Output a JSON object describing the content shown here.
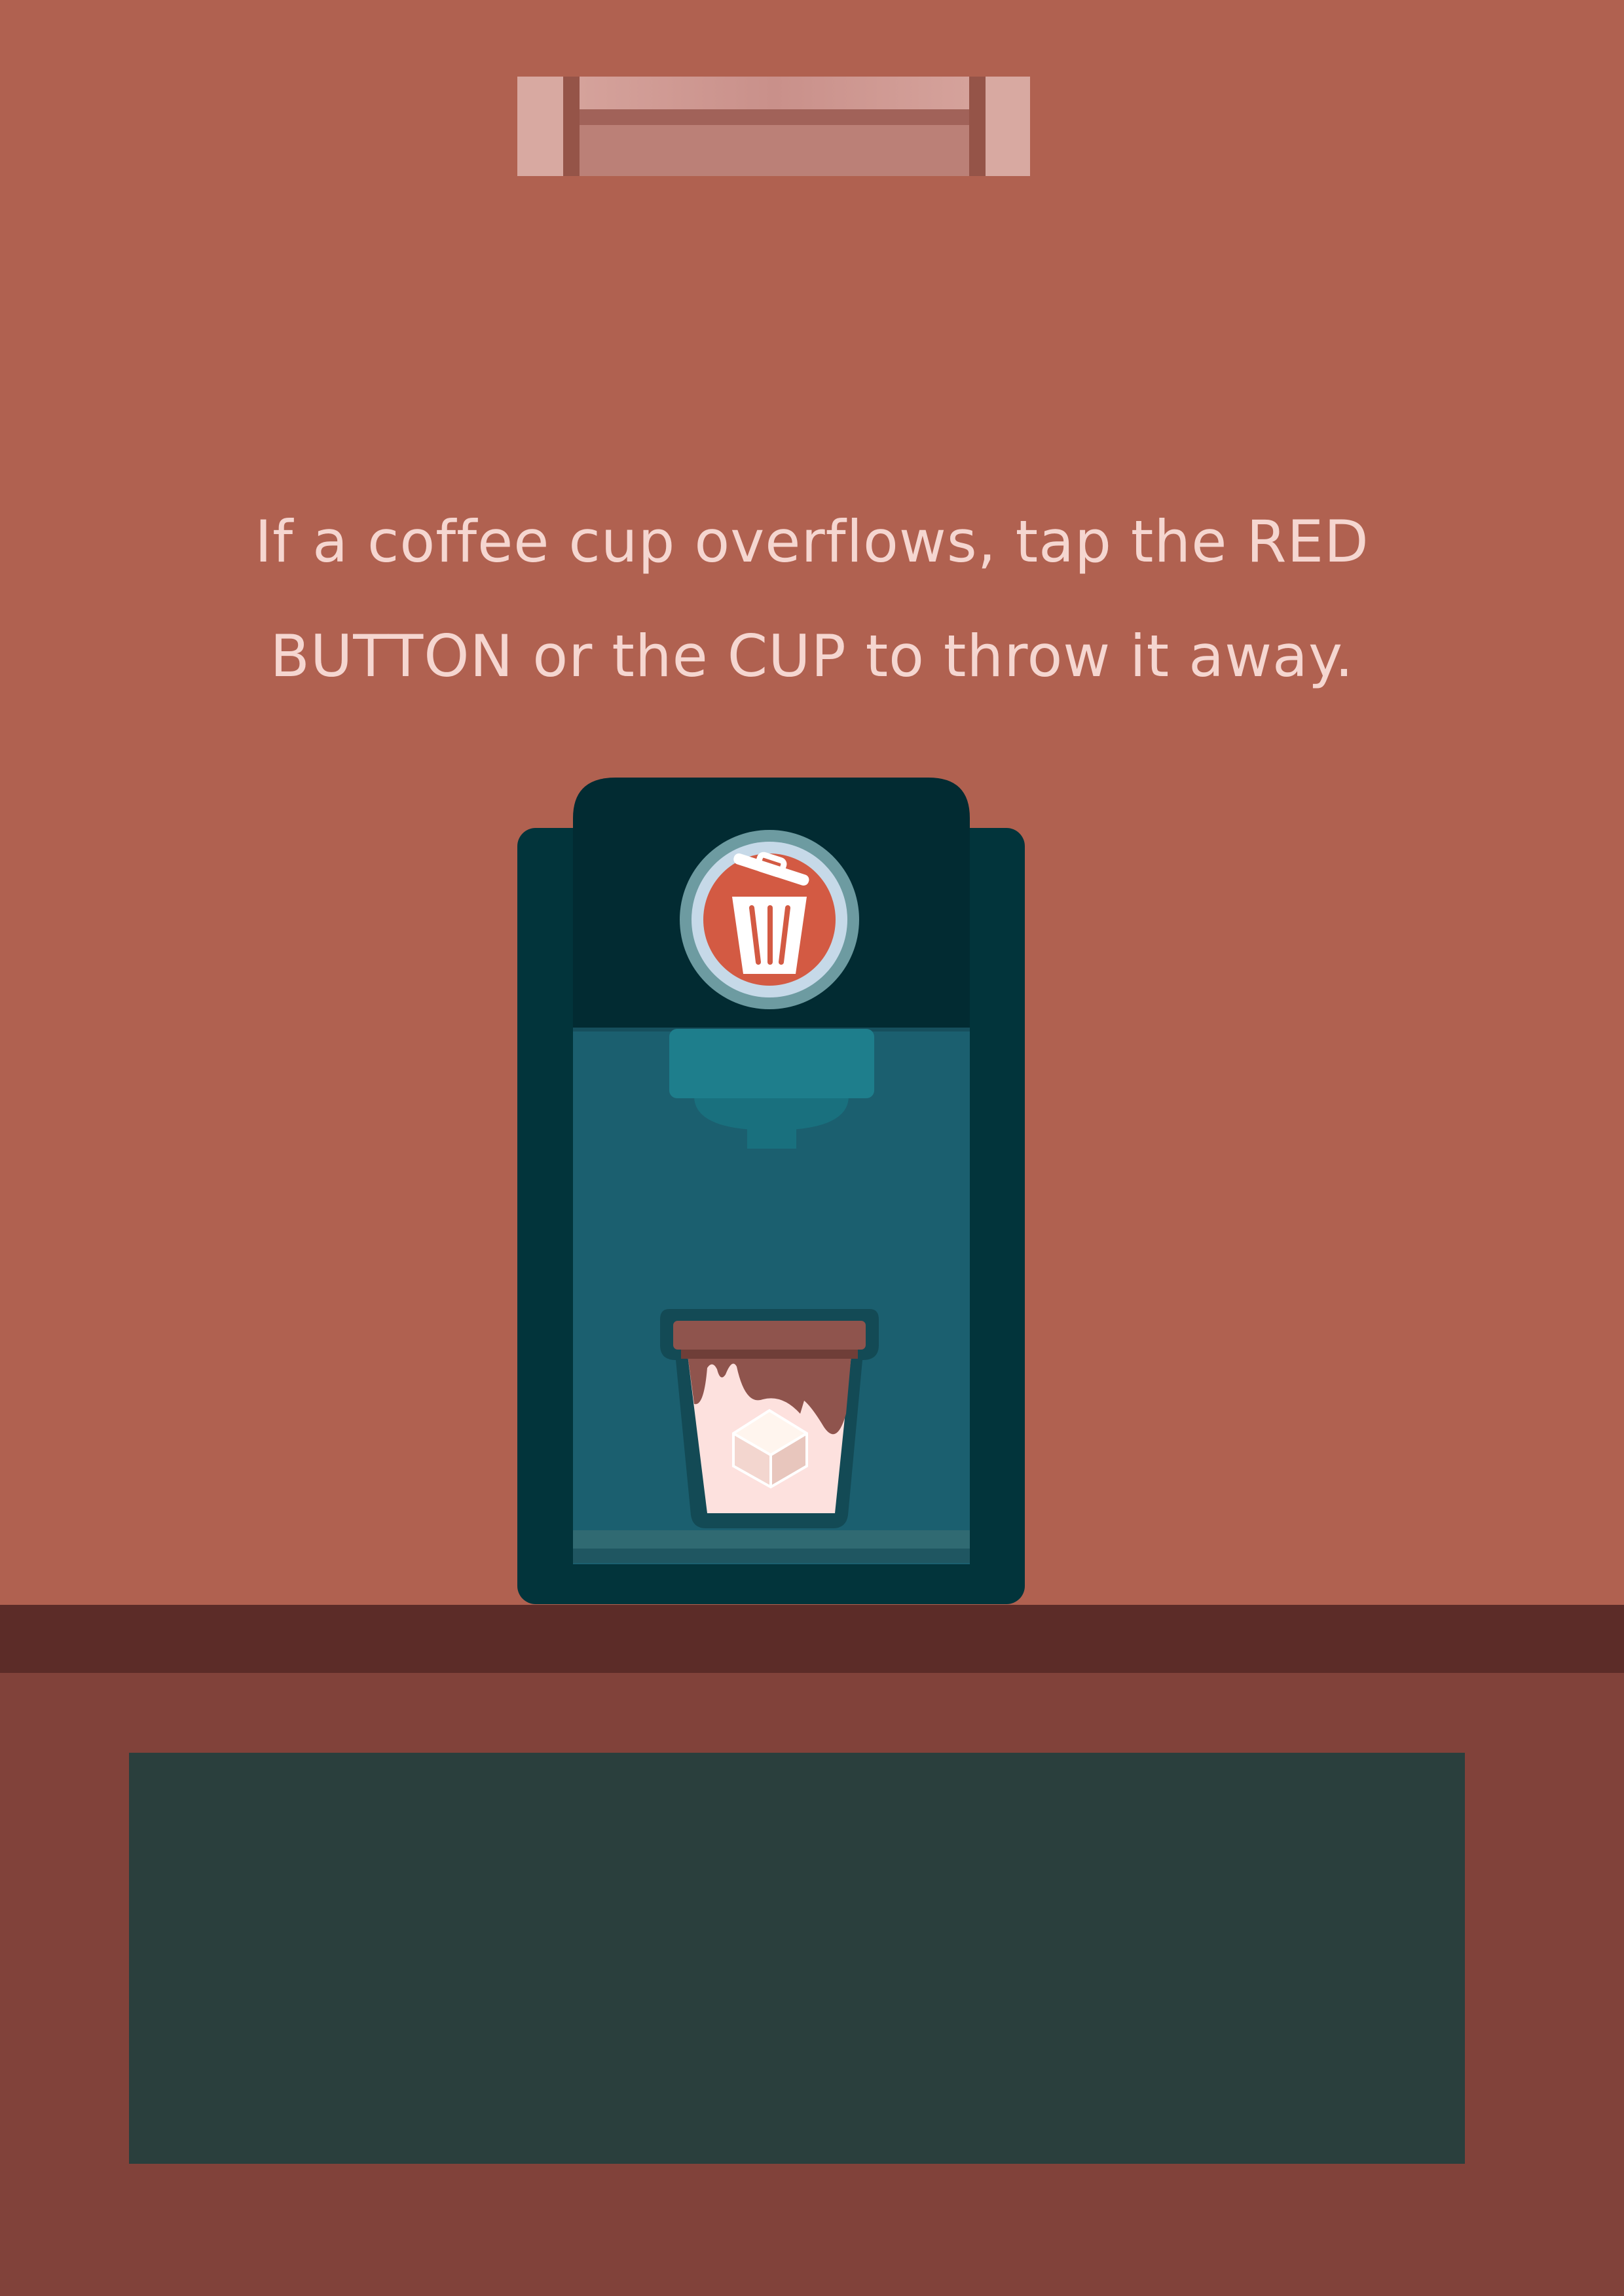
{
  "instruction": {
    "line1": "If a coffee cup overflows, tap the RED",
    "line2": "BUTTON or the CUP to throw it away."
  },
  "icons": {
    "trash_button": "trash-can-icon",
    "cup": "coffee-cup-icon",
    "sugar": "sugar-cube-icon",
    "menu_handle": "pause-handle-icon"
  },
  "colors": {
    "wall": "#b06150",
    "counter_top": "#5c2c28",
    "counter_front": "#81423a",
    "counter_panel": "#2a3f3d",
    "machine_body": "#023239",
    "machine_head": "#022b32",
    "machine_window": "#1b5f6f",
    "red_button": "#d35a43",
    "text": "#f5d6d0"
  }
}
